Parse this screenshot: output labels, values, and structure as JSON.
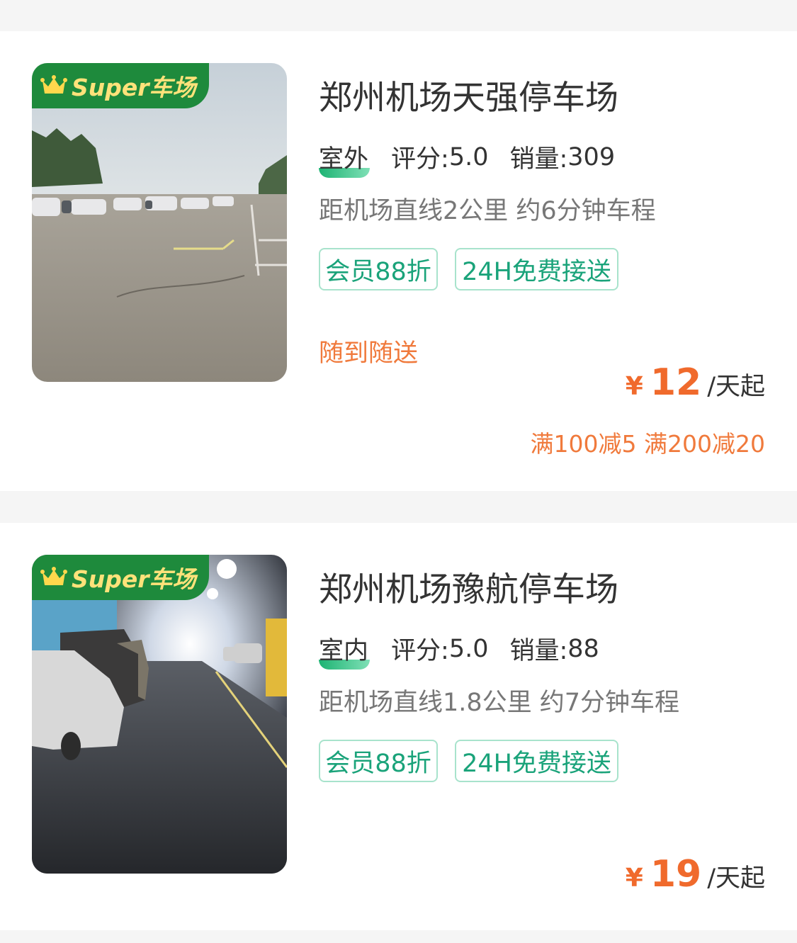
{
  "colors": {
    "background": "#f5f5f5",
    "card": "#ffffff",
    "badge_green": "#1e8a3c",
    "badge_text": "#ffe27a",
    "tag_green": "#1aa37a",
    "tag_border": "#a8e3cc",
    "accent_orange": "#f06a2c",
    "title_text": "#333333",
    "secondary_text": "#777777"
  },
  "listings": [
    {
      "badge": "Super车场",
      "badge_icon": "crown-icon",
      "photo": "outdoor-parking-lot-photo",
      "title": "郑州机场天强停车场",
      "environment": "室外",
      "rating_label": "评分:",
      "rating": "5.0",
      "sales_label": "销量:",
      "sales": "309",
      "distance": "距机场直线2公里 约6分钟车程",
      "tags": [
        "会员88折",
        "24H免费接送"
      ],
      "service_note": "随到随送",
      "currency": "¥",
      "price": "12",
      "price_unit": "/天起",
      "discount": "满100减5 满200减20"
    },
    {
      "badge": "Super车场",
      "badge_icon": "crown-icon",
      "photo": "indoor-parking-garage-photo",
      "title": "郑州机场豫航停车场",
      "environment": "室内",
      "rating_label": "评分:",
      "rating": "5.0",
      "sales_label": "销量:",
      "sales": "88",
      "distance": "距机场直线1.8公里 约7分钟车程",
      "tags": [
        "会员88折",
        "24H免费接送"
      ],
      "currency": "¥",
      "price": "19",
      "price_unit": "/天起"
    }
  ]
}
